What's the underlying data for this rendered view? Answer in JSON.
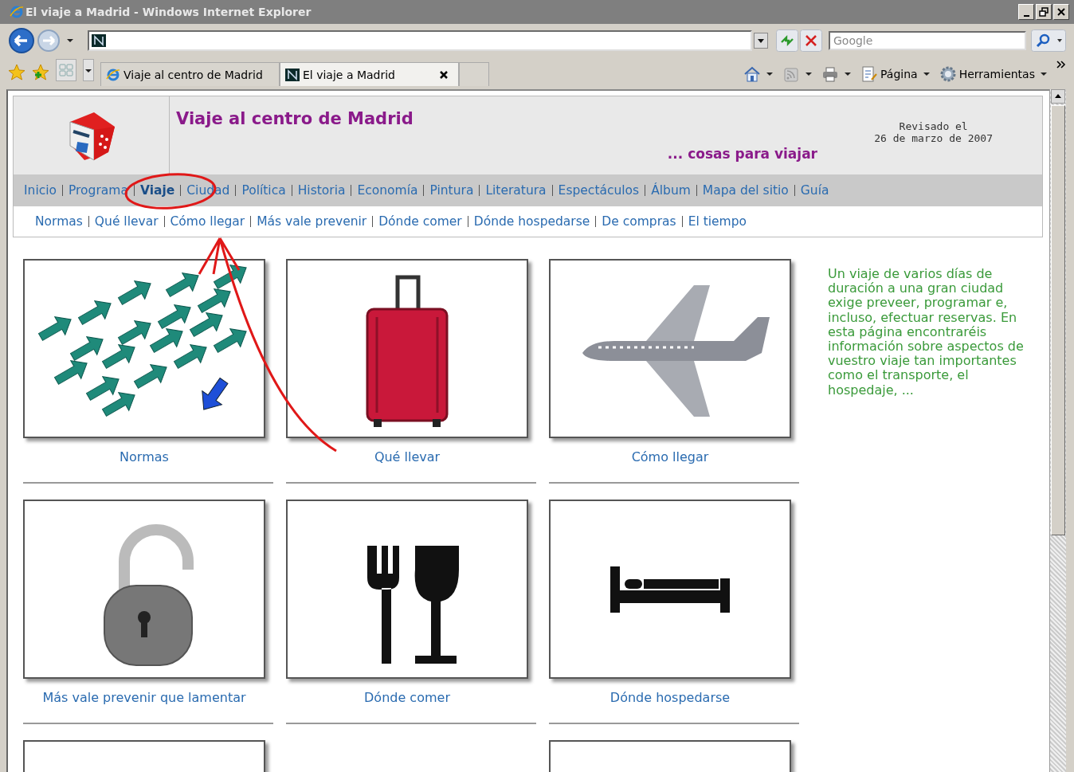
{
  "window": {
    "title": "El viaje a Madrid - Windows Internet Explorer"
  },
  "search": {
    "placeholder": "Google"
  },
  "tabs": [
    {
      "label": "Viaje al centro de Madrid",
      "selected": false
    },
    {
      "label": "El viaje a Madrid",
      "selected": true
    }
  ],
  "command_bar": [
    {
      "kind": "home"
    },
    {
      "kind": "feed"
    },
    {
      "kind": "print"
    },
    {
      "kind": "page",
      "label": "Página"
    },
    {
      "kind": "tools",
      "label": "Herramientas"
    }
  ],
  "page": {
    "site_title": "Viaje al centro de Madrid",
    "revised": [
      "Revisado el",
      "26 de marzo de 2007"
    ],
    "tagline": "... cosas para viajar",
    "main_nav": [
      {
        "label": "Inicio",
        "selected": false
      },
      {
        "label": "Programa",
        "selected": false
      },
      {
        "label": "Viaje",
        "selected": true
      },
      {
        "label": "Ciudad",
        "selected": false
      },
      {
        "label": "Política",
        "selected": false
      },
      {
        "label": "Historia",
        "selected": false
      },
      {
        "label": "Economía",
        "selected": false
      },
      {
        "label": "Pintura",
        "selected": false
      },
      {
        "label": "Literatura",
        "selected": false
      },
      {
        "label": "Espectáculos",
        "selected": false
      },
      {
        "label": "Álbum",
        "selected": false
      },
      {
        "label": "Mapa del sitio",
        "selected": false
      },
      {
        "label": "Guía",
        "selected": false
      }
    ],
    "sub_nav": [
      "Normas",
      "Qué llevar",
      "Cómo llegar",
      "Más vale prevenir",
      "Dónde comer",
      "Dónde hospedarse",
      "De compras",
      "El tiempo"
    ],
    "cards": [
      {
        "kind": "arrows",
        "caption": "Normas"
      },
      {
        "kind": "suitcase",
        "caption": "Qué llevar"
      },
      {
        "kind": "plane",
        "caption": "Cómo llegar"
      },
      {
        "kind": "padlock",
        "caption": "Más vale prevenir que lamentar"
      },
      {
        "kind": "dining",
        "caption": "Dónde comer"
      },
      {
        "kind": "bed",
        "caption": "Dónde hospedarse"
      },
      {
        "kind": "partial"
      },
      {
        "kind": "empty"
      },
      {
        "kind": "partial"
      }
    ],
    "intro": "Un viaje de varios días de duración a una gran ciudad exige preveer, programar e, incluso, efectuar reservas. En esta página encontraréis información sobre aspectos de vuestro viaje tan importantes como el transporte, el hospedaje, ..."
  }
}
